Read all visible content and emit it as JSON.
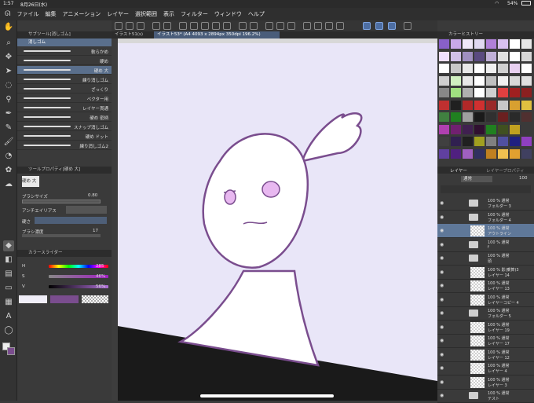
{
  "status": {
    "time": "1:57",
    "date": "8月26日(水)",
    "battery": "54%"
  },
  "menu": [
    "ファイル",
    "編集",
    "アニメーション",
    "レイヤー",
    "選択範囲",
    "表示",
    "フィルター",
    "ウィンドウ",
    "ヘルプ"
  ],
  "subtool": {
    "header": "サブツール[消しゴム]",
    "group": "消しゴム",
    "items": [
      "軟らかめ",
      "硬め",
      "硬め 大",
      "練り消しゴム",
      "ざっくり",
      "ベクター用",
      "レイヤー貫通",
      "硬め 密柄",
      "スナップ消しゴム",
      "硬め ドット",
      "練り消しゴム2"
    ],
    "active_index": 2
  },
  "tool_property": {
    "header": "ツールプロパティ[硬め 大]",
    "tool_name": "硬め 大",
    "brush_size_label": "ブラシサイズ",
    "brush_size_value": "0.80",
    "antialias_label": "アンチエイリアス",
    "hardness_label": "硬さ",
    "brush_density_label": "ブラシ濃度",
    "brush_density_value": "17"
  },
  "color_slider": {
    "header": "カラースライダー",
    "h_label": "H",
    "h_value": "285",
    "s_label": "S",
    "s_value": "46%",
    "v_label": "V",
    "v_value": "56%"
  },
  "canvas": {
    "tab_inactive": "イラスト51(s)",
    "tab_active": "イラスト53* (A4 4093 x 2894px 350dpi 196.2%)",
    "background_color": "#e9e6f8",
    "line_color": "#7a4d8e"
  },
  "color_history": {
    "header": "カラーヒストリー"
  },
  "layers": {
    "tab_layer": "レイヤー",
    "tab_prop": "レイヤープロパティ",
    "blend_mode": "通常",
    "opacity": "100",
    "items": [
      {
        "l1": "100 % 通常",
        "l2": "フォルダー 3",
        "type": "folder",
        "selected": false
      },
      {
        "l1": "100 % 通常",
        "l2": "フォルダー 4",
        "type": "folder",
        "selected": false
      },
      {
        "l1": "100 % 通常",
        "l2": "アウトライン",
        "type": "layer",
        "selected": true
      },
      {
        "l1": "100 % 通常",
        "l2": "f",
        "type": "folder",
        "selected": false
      },
      {
        "l1": "100 % 通常",
        "l2": "頭",
        "type": "folder",
        "selected": false
      },
      {
        "l1": "100 % 影(乗算)3",
        "l2": "レイヤー 14",
        "type": "layer",
        "selected": false
      },
      {
        "l1": "100 % 通常",
        "l2": "レイヤー 13",
        "type": "layer",
        "selected": false
      },
      {
        "l1": "100 % 通常",
        "l2": "レイヤーコピー 4",
        "type": "layer",
        "selected": false
      },
      {
        "l1": "100 % 通常",
        "l2": "フォルダー 5",
        "type": "folder",
        "selected": false
      },
      {
        "l1": "100 % 通常",
        "l2": "レイヤー 19",
        "type": "layer",
        "selected": false
      },
      {
        "l1": "100 % 通常",
        "l2": "レイヤー 17",
        "type": "layer",
        "selected": false
      },
      {
        "l1": "100 % 通常",
        "l2": "レイヤー 12",
        "type": "layer",
        "selected": false
      },
      {
        "l1": "100 % 通常",
        "l2": "レイヤー 4",
        "type": "layer",
        "selected": false
      },
      {
        "l1": "100 % 通常",
        "l2": "レイヤー 3",
        "type": "layer",
        "selected": false
      },
      {
        "l1": "100 % 通常",
        "l2": "テスト",
        "type": "folder",
        "selected": false
      }
    ]
  }
}
